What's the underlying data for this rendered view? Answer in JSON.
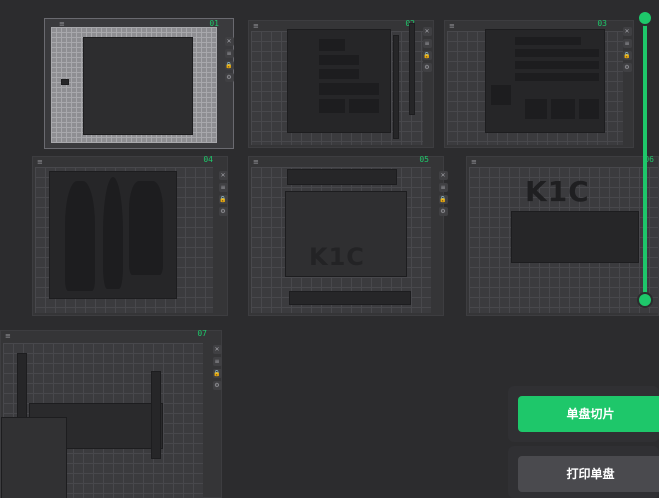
{
  "plates": [
    {
      "number": "01"
    },
    {
      "number": "02"
    },
    {
      "number": "03"
    },
    {
      "number": "04"
    },
    {
      "number": "05"
    },
    {
      "number": "06"
    },
    {
      "number": "07"
    }
  ],
  "model_labels": {
    "k1c_a": "K1C",
    "k1c_b": "K1C"
  },
  "tools": {
    "close": "✕",
    "menu": "≡",
    "lock": "🔒",
    "settings": "⚙",
    "plate_menu": "≡"
  },
  "actions": {
    "slice_plate": "单盘切片",
    "print_plate": "打印单盘"
  },
  "colors": {
    "accent": "#1ec76a",
    "background": "#2c2c2e"
  },
  "layer_slider": {
    "top_value": 1.0,
    "bottom_value": 0.0
  }
}
